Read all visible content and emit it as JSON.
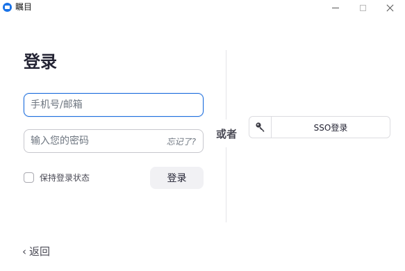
{
  "window": {
    "title": "瞩目",
    "logo_icon": "app-logo-icon",
    "controls": [
      "minimize-icon",
      "maximize-icon",
      "close-icon"
    ]
  },
  "login": {
    "heading": "登录",
    "account_placeholder": "手机号/邮箱",
    "account_value": "",
    "password_placeholder": "输入您的密码",
    "password_value": "",
    "forgot_label": "忘记了?",
    "remember_label": "保持登录状态",
    "remember_checked": false,
    "submit_label": "登录"
  },
  "separator": {
    "label": "或者"
  },
  "sso": {
    "icon": "key-icon",
    "label": "SSO登录"
  },
  "back": {
    "icon": "chevron-left-icon",
    "label": "返回"
  },
  "colors": {
    "focus_border": "#1f6fde",
    "logo": "#1a73e8",
    "button_bg": "#f1f1f4"
  }
}
